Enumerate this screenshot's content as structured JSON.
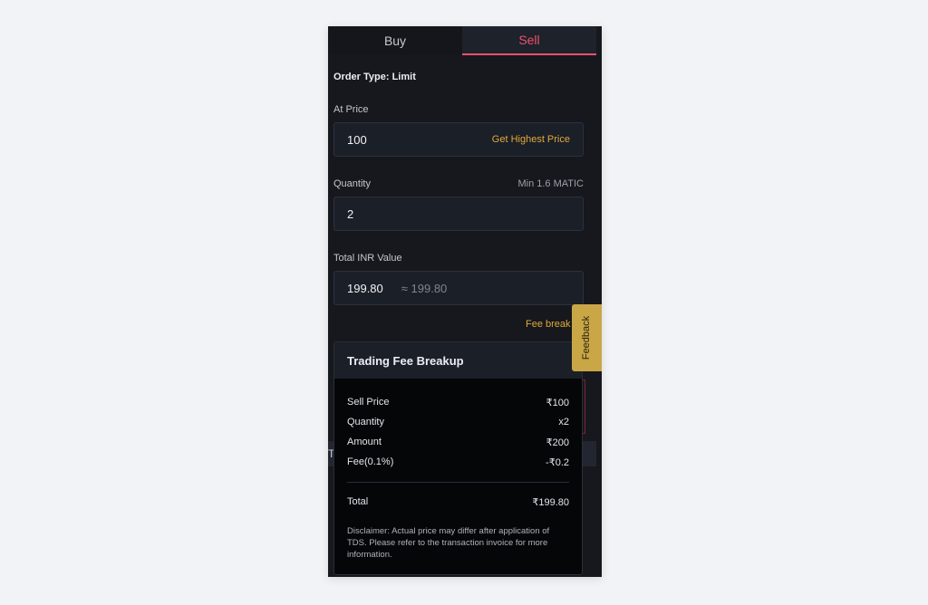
{
  "tabs": {
    "buy": "Buy",
    "sell": "Sell"
  },
  "order_type": "Order Type: Limit",
  "at_price": {
    "label": "At Price",
    "value": "100",
    "action": "Get Highest Price"
  },
  "quantity": {
    "label": "Quantity",
    "hint": "Min 1.6 MATIC",
    "value": "2"
  },
  "total": {
    "label": "Total INR Value",
    "value": "199.80",
    "approx": "≈ 199.80"
  },
  "fee_link": "Fee break",
  "background_fragment": "T",
  "fee_breakup": {
    "title": "Trading Fee Breakup",
    "rows": [
      {
        "label": "Sell Price",
        "value": "₹100"
      },
      {
        "label": "Quantity",
        "value": "x2"
      },
      {
        "label": "Amount",
        "value": "₹200"
      },
      {
        "label": "Fee(0.1%)",
        "value": "-₹0.2"
      }
    ],
    "total": {
      "label": "Total",
      "value": "₹199.80"
    },
    "disclaimer": "Disclaimer: Actual price may differ after application of TDS. Please refer to the transaction invoice for more information."
  },
  "feedback": "Feedback",
  "colors": {
    "sell": "#f0506e",
    "accent": "#e0a93a",
    "feedback_bg": "#c9a646"
  }
}
